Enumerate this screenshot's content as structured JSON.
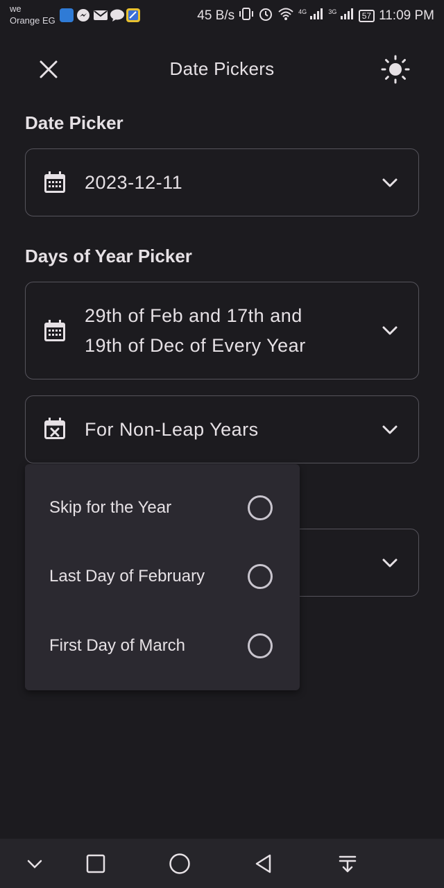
{
  "status_bar": {
    "carrier_line1": "we",
    "carrier_line2": "Orange EG",
    "notification_icons": [
      "shield-icon",
      "messenger-icon",
      "mail-icon",
      "chat-bubble-icon",
      "app-icon"
    ],
    "net_speed": "45 B/s",
    "signal1_label": "4G",
    "signal2_label": "3G",
    "battery": "57",
    "time": "11:09 PM"
  },
  "app_bar": {
    "title": "Date Pickers",
    "close_icon": "close-icon",
    "theme_icon": "sun-icon"
  },
  "date_picker": {
    "label": "Date Picker",
    "value": "2023-12-11"
  },
  "days_of_year_picker": {
    "label": "Days of Year Picker",
    "value_line1": "29th of Feb and 17th and",
    "value_line2": "19th of Dec of Every Year"
  },
  "non_leap_field": {
    "value": "For Non-Leap Years"
  },
  "menu": {
    "options": [
      {
        "label": "Skip for the Year",
        "selected": false
      },
      {
        "label": "Last Day of February",
        "selected": false
      },
      {
        "label": "First Day of March",
        "selected": false
      }
    ]
  },
  "nav_bar": {
    "buttons": [
      "chevron-down-icon",
      "square-icon",
      "circle-home-icon",
      "back-triangle-icon",
      "notification-pull-icon"
    ]
  },
  "colors": {
    "background": "#1c1b1f",
    "surface_menu": "#2b2930",
    "outline": "#56545c",
    "on_surface": "#e6e1e5"
  }
}
